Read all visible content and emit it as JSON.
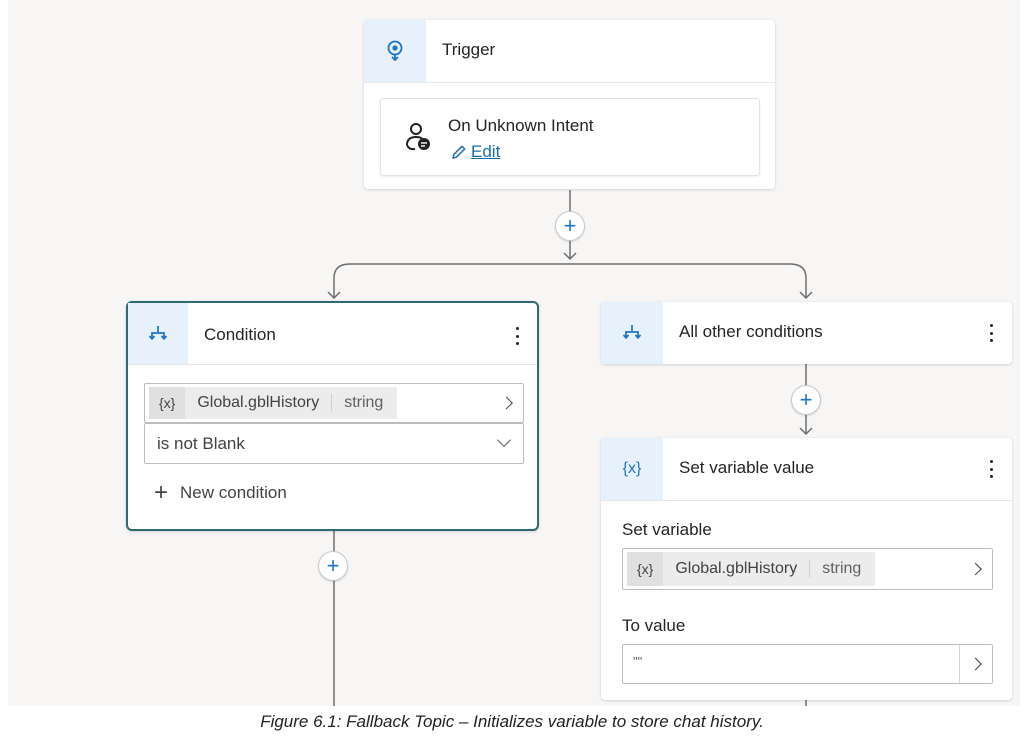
{
  "trigger": {
    "title": "Trigger",
    "intent_label": "On Unknown Intent",
    "edit_label": "Edit"
  },
  "condition": {
    "title": "Condition",
    "variable": {
      "badge": "{x}",
      "name": "Global.gblHistory",
      "type": "string"
    },
    "operator": "is not Blank",
    "new_condition_label": "New condition"
  },
  "other_conditions": {
    "title": "All other conditions"
  },
  "set_variable": {
    "title": "Set variable value",
    "header_badge": "{x}",
    "set_variable_label": "Set variable",
    "variable": {
      "badge": "{x}",
      "name": "Global.gblHistory",
      "type": "string"
    },
    "to_value_label": "To value",
    "to_value": "\"\""
  },
  "caption": "Figure 6.1: Fallback Topic – Initializes variable to store chat history.",
  "colors": {
    "canvas": "#f7f6f5",
    "accent": "#1b74c8",
    "selected_border": "#2b6b73",
    "icon_bg": "#e7f1fb",
    "connector": "#6e6e6e"
  },
  "icons": {
    "trigger": "trigger-bulb-icon",
    "intent": "person-chat-icon",
    "edit": "pencil-icon",
    "condition": "branch-icon",
    "variable": "variable-icon",
    "add": "plus-icon"
  }
}
